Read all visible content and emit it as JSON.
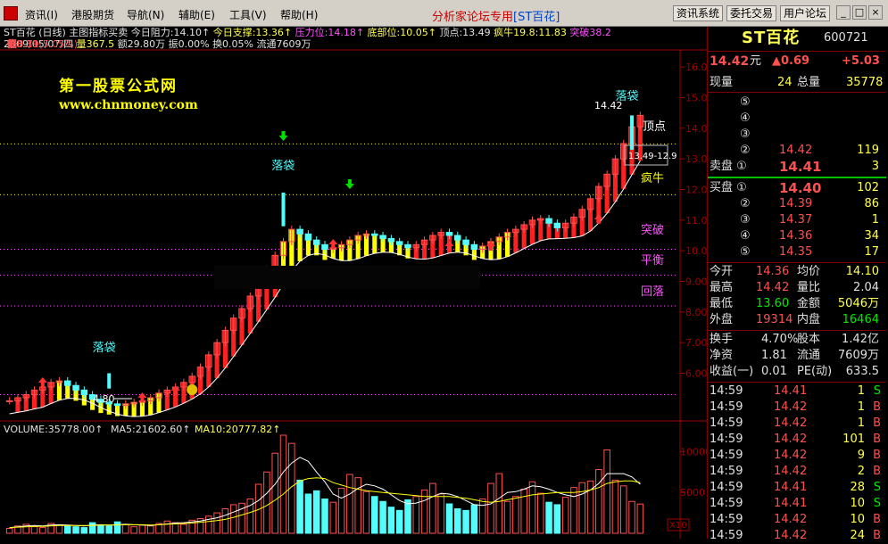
{
  "menu": {
    "items": [
      "资讯(I)",
      "港股期货",
      "导航(N)",
      "辅助(E)",
      "工具(V)",
      "帮助(H)"
    ],
    "center_title": "分析家论坛专用",
    "center_stock": "[ST百花]",
    "right_buttons": [
      "资讯系统",
      "委托交易",
      "用户论坛"
    ],
    "window_buttons": [
      "_",
      "□",
      "×"
    ]
  },
  "info": {
    "line1": [
      {
        "t": "ST百花 (日线) 主图指标买卖 ",
        "c": "w"
      },
      {
        "t": "今日阻力:14.10↑",
        "c": "w"
      },
      {
        "t": " 今日支撑:13.36↑",
        "c": "y"
      },
      {
        "t": " 压力位:14.18↑",
        "c": "m"
      },
      {
        "t": " 底部位:10.05↑",
        "c": "y"
      },
      {
        "t": " 顶点:13.49",
        "c": "w"
      },
      {
        "t": " 疯牛19.8:11.83",
        "c": "y"
      },
      {
        "t": " 突破38.2",
        "c": "m"
      }
    ],
    "line2": [
      {
        "t": "2009/05/07/四 ",
        "c": "w"
      },
      {
        "t": "开8.11 ",
        "c": "r"
      },
      {
        "t": "高8.11 ",
        "c": "r"
      },
      {
        "t": "低8.11 ",
        "c": "r"
      },
      {
        "t": "收8.11 ",
        "c": "r"
      },
      {
        "t": "量367.5 ",
        "c": "y"
      },
      {
        "t": "额29.80万 ",
        "c": "w"
      },
      {
        "t": "幅0.39(5.05%) ",
        "c": "r"
      },
      {
        "t": "振0.00% ",
        "c": "w"
      },
      {
        "t": "换0.05% ",
        "c": "w"
      },
      {
        "t": "流通7609万",
        "c": "w"
      }
    ]
  },
  "watermark": {
    "line1": "第一股票公式网",
    "line2": "www.chnmoney.com"
  },
  "chart_labels": {
    "luodai": [
      "落袋",
      "落袋",
      "落袋"
    ],
    "high_label": "14.42",
    "low_label": "4.80",
    "dingdian": "顶点",
    "range_label": "13.49-12.9",
    "fengniu": "疯牛",
    "tupo": "突破",
    "pingheng": "平衡",
    "huiluo": "回落"
  },
  "axis": {
    "price_ticks": [
      "16.00",
      "15.00",
      "14.00",
      "13.00",
      "12.00",
      "11.00",
      "10.00",
      "9.00",
      "8.00",
      "7.00",
      "6.00"
    ],
    "vol_ticks": [
      "10000",
      "5000"
    ],
    "vol_unit": "X10"
  },
  "volume_bar": {
    "vol": "VOLUME:35778.00↑",
    "ma5": "MA5:21602.60↑",
    "ma10": "MA10:20777.82↑"
  },
  "chart_data": {
    "type": "candlestick",
    "price_range": [
      4.5,
      16.5
    ],
    "volume_range": [
      0,
      12000
    ],
    "closes": [
      5.1,
      5.2,
      5.3,
      5.45,
      5.55,
      5.7,
      5.75,
      5.6,
      5.45,
      5.3,
      5.15,
      5.05,
      5.0,
      4.95,
      5.0,
      5.05,
      5.1,
      5.2,
      5.35,
      5.45,
      5.55,
      5.7,
      5.9,
      6.2,
      6.6,
      7.0,
      7.4,
      7.8,
      8.11,
      8.52,
      8.95,
      9.4,
      9.85,
      10.3,
      10.7,
      10.55,
      10.35,
      10.2,
      10.05,
      10.1,
      10.2,
      10.35,
      10.5,
      10.55,
      10.5,
      10.4,
      10.3,
      10.2,
      10.1,
      10.2,
      10.35,
      10.5,
      10.6,
      10.5,
      10.35,
      10.2,
      10.05,
      10.15,
      10.3,
      10.45,
      10.6,
      10.7,
      10.85,
      11.0,
      11.05,
      10.9,
      10.75,
      10.9,
      11.1,
      11.35,
      11.7,
      12.1,
      12.5,
      13.0,
      13.5,
      14.05,
      14.42
    ],
    "volumes": [
      600,
      900,
      1100,
      800,
      700,
      1200,
      1000,
      900,
      800,
      700,
      1300,
      1000,
      900,
      1400,
      1100,
      800,
      1000,
      900,
      1200,
      1500,
      1300,
      1100,
      1600,
      1800,
      2100,
      2500,
      3000,
      3500,
      3675,
      4200,
      6000,
      7500,
      9800,
      12000,
      11000,
      6500,
      4800,
      5200,
      4200,
      3800,
      5500,
      7200,
      6800,
      5100,
      4500,
      3900,
      3200,
      2800,
      4100,
      4500,
      5300,
      6100,
      4800,
      3600,
      3000,
      2800,
      3500,
      4200,
      6100,
      7300,
      3900,
      4500,
      5400,
      6300,
      4900,
      3800,
      3500,
      4400,
      5600,
      6200,
      6400,
      7800,
      10200,
      6500,
      5800,
      3900,
      3578
    ],
    "ma5": [
      700,
      800,
      900,
      950,
      900,
      1000,
      1050,
      1000,
      950,
      900,
      1000,
      1050,
      1000,
      1050,
      1100,
      1050,
      1000,
      950,
      1050,
      1150,
      1250,
      1300,
      1400,
      1500,
      1700,
      1900,
      2200,
      2600,
      3000,
      3400,
      4000,
      4900,
      6000,
      7500,
      8600,
      9300,
      8800,
      7500,
      6300,
      4800,
      4300,
      4800,
      5500,
      6000,
      5800,
      5400,
      4700,
      4000,
      3600,
      3700,
      4000,
      4500,
      4900,
      4800,
      4500,
      4000,
      3500,
      3400,
      3600,
      4300,
      5000,
      5100,
      5400,
      5800,
      5700,
      5400,
      5000,
      4700,
      4500,
      4800,
      5300,
      6100,
      7300,
      7300,
      7300,
      6900,
      6000
    ],
    "ma10": [
      700,
      750,
      800,
      850,
      850,
      900,
      950,
      950,
      950,
      950,
      950,
      1000,
      1000,
      1000,
      1050,
      1050,
      1050,
      1000,
      1050,
      1100,
      1150,
      1200,
      1250,
      1350,
      1450,
      1550,
      1700,
      1950,
      2250,
      2550,
      2900,
      3400,
      4050,
      4800,
      5700,
      6400,
      6700,
      6800,
      6700,
      6200,
      5900,
      5600,
      5400,
      5200,
      5100,
      5000,
      4900,
      4800,
      4700,
      4600,
      4500,
      4500,
      4500,
      4500,
      4400,
      4300,
      4100,
      3900,
      3800,
      3900,
      4100,
      4300,
      4500,
      4700,
      4800,
      4900,
      5000,
      5000,
      5000,
      5100,
      5300,
      5600,
      6100,
      6300,
      6400,
      6400,
      6200
    ]
  },
  "side": {
    "name": "ST百花",
    "code": "600721",
    "price": "14.42",
    "price_unit": "元",
    "change": "▲0.69",
    "change_pct": "+5.03",
    "xianliang_label": "现量",
    "xianliang": "24",
    "zongliang_label": "总量",
    "zongliang": "35778",
    "sell": [
      {
        "lbl": "⑤",
        "p": "",
        "v": ""
      },
      {
        "lbl": "④",
        "p": "",
        "v": ""
      },
      {
        "lbl": "③",
        "p": "",
        "v": ""
      },
      {
        "lbl": "②",
        "p": "14.42",
        "v": "119"
      },
      {
        "lbl": "卖盘 ①",
        "p": "14.41",
        "v": "3"
      }
    ],
    "buy": [
      {
        "lbl": "买盘 ①",
        "p": "14.40",
        "v": "102"
      },
      {
        "lbl": "②",
        "p": "14.39",
        "v": "86"
      },
      {
        "lbl": "③",
        "p": "14.37",
        "v": "1"
      },
      {
        "lbl": "④",
        "p": "14.36",
        "v": "34"
      },
      {
        "lbl": "⑤",
        "p": "14.35",
        "v": "17"
      }
    ],
    "stats": [
      {
        "l1": "今开",
        "v1": "14.36",
        "c1": "r",
        "l2": "均价",
        "v2": "14.10",
        "c2": "y"
      },
      {
        "l1": "最高",
        "v1": "14.42",
        "c1": "r",
        "l2": "量比",
        "v2": "2.04",
        "c2": "w"
      },
      {
        "l1": "最低",
        "v1": "13.60",
        "c1": "g",
        "l2": "金额",
        "v2": "5046万",
        "c2": "y"
      },
      {
        "l1": "外盘",
        "v1": "19314",
        "c1": "r",
        "l2": "内盘",
        "v2": "16464",
        "c2": "g"
      }
    ],
    "stats2": [
      {
        "l1": "换手",
        "v1": "4.70%",
        "l2": "股本",
        "v2": "1.42亿"
      },
      {
        "l1": "净资",
        "v1": "1.81",
        "l2": "流通",
        "v2": "7609万"
      },
      {
        "l1": "收益(一)",
        "v1": "0.01",
        "l2": "PE(动)",
        "v2": "633.5"
      }
    ],
    "ticks": [
      {
        "t": "14:59",
        "p": "14.41",
        "v": "1",
        "s": "S"
      },
      {
        "t": "14:59",
        "p": "14.42",
        "v": "1",
        "s": "B"
      },
      {
        "t": "14:59",
        "p": "14.42",
        "v": "1",
        "s": "B"
      },
      {
        "t": "14:59",
        "p": "14.42",
        "v": "101",
        "s": "B"
      },
      {
        "t": "14:59",
        "p": "14.42",
        "v": "9",
        "s": "B"
      },
      {
        "t": "14:59",
        "p": "14.42",
        "v": "2",
        "s": "B"
      },
      {
        "t": "14:59",
        "p": "14.41",
        "v": "28",
        "s": "S"
      },
      {
        "t": "14:59",
        "p": "14.41",
        "v": "10",
        "s": "S"
      },
      {
        "t": "14:59",
        "p": "14.42",
        "v": "10",
        "s": "B"
      },
      {
        "t": "14:59",
        "p": "14.42",
        "v": "24",
        "s": "B"
      }
    ]
  }
}
